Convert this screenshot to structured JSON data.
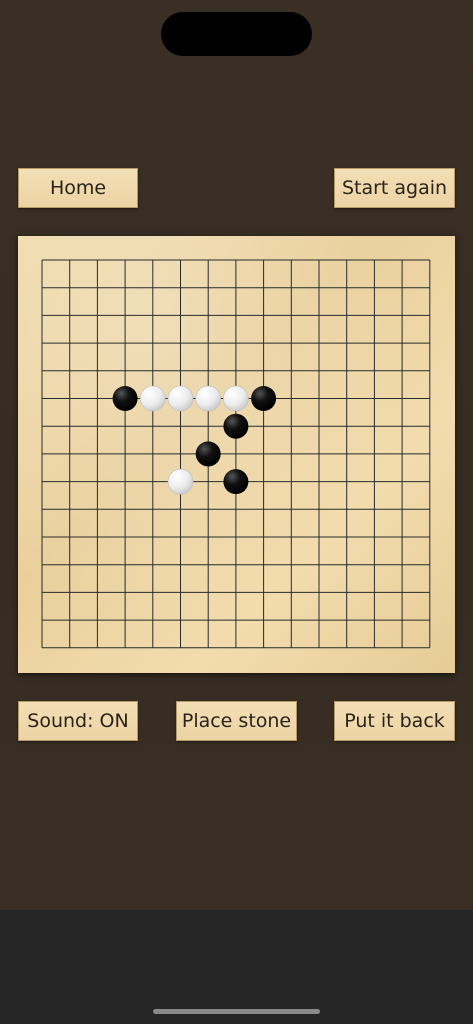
{
  "buttons": {
    "home": "Home",
    "start_again": "Start again",
    "sound": "Sound: ON",
    "place_stone": "Place stone",
    "put_it_back": "Put it back"
  },
  "board": {
    "grid_size": 15,
    "stones": [
      {
        "col": 3,
        "row": 5,
        "color": "black"
      },
      {
        "col": 4,
        "row": 5,
        "color": "white"
      },
      {
        "col": 5,
        "row": 5,
        "color": "white"
      },
      {
        "col": 6,
        "row": 5,
        "color": "white"
      },
      {
        "col": 7,
        "row": 5,
        "color": "white"
      },
      {
        "col": 8,
        "row": 5,
        "color": "black"
      },
      {
        "col": 7,
        "row": 6,
        "color": "black"
      },
      {
        "col": 6,
        "row": 7,
        "color": "black"
      },
      {
        "col": 5,
        "row": 8,
        "color": "white"
      },
      {
        "col": 7,
        "row": 8,
        "color": "black"
      }
    ]
  },
  "colors": {
    "background": "#3a2f24",
    "board_wood": "#eed6a6",
    "grid_line": "#2a2a2a",
    "button_wood": "#f0dbb0"
  }
}
